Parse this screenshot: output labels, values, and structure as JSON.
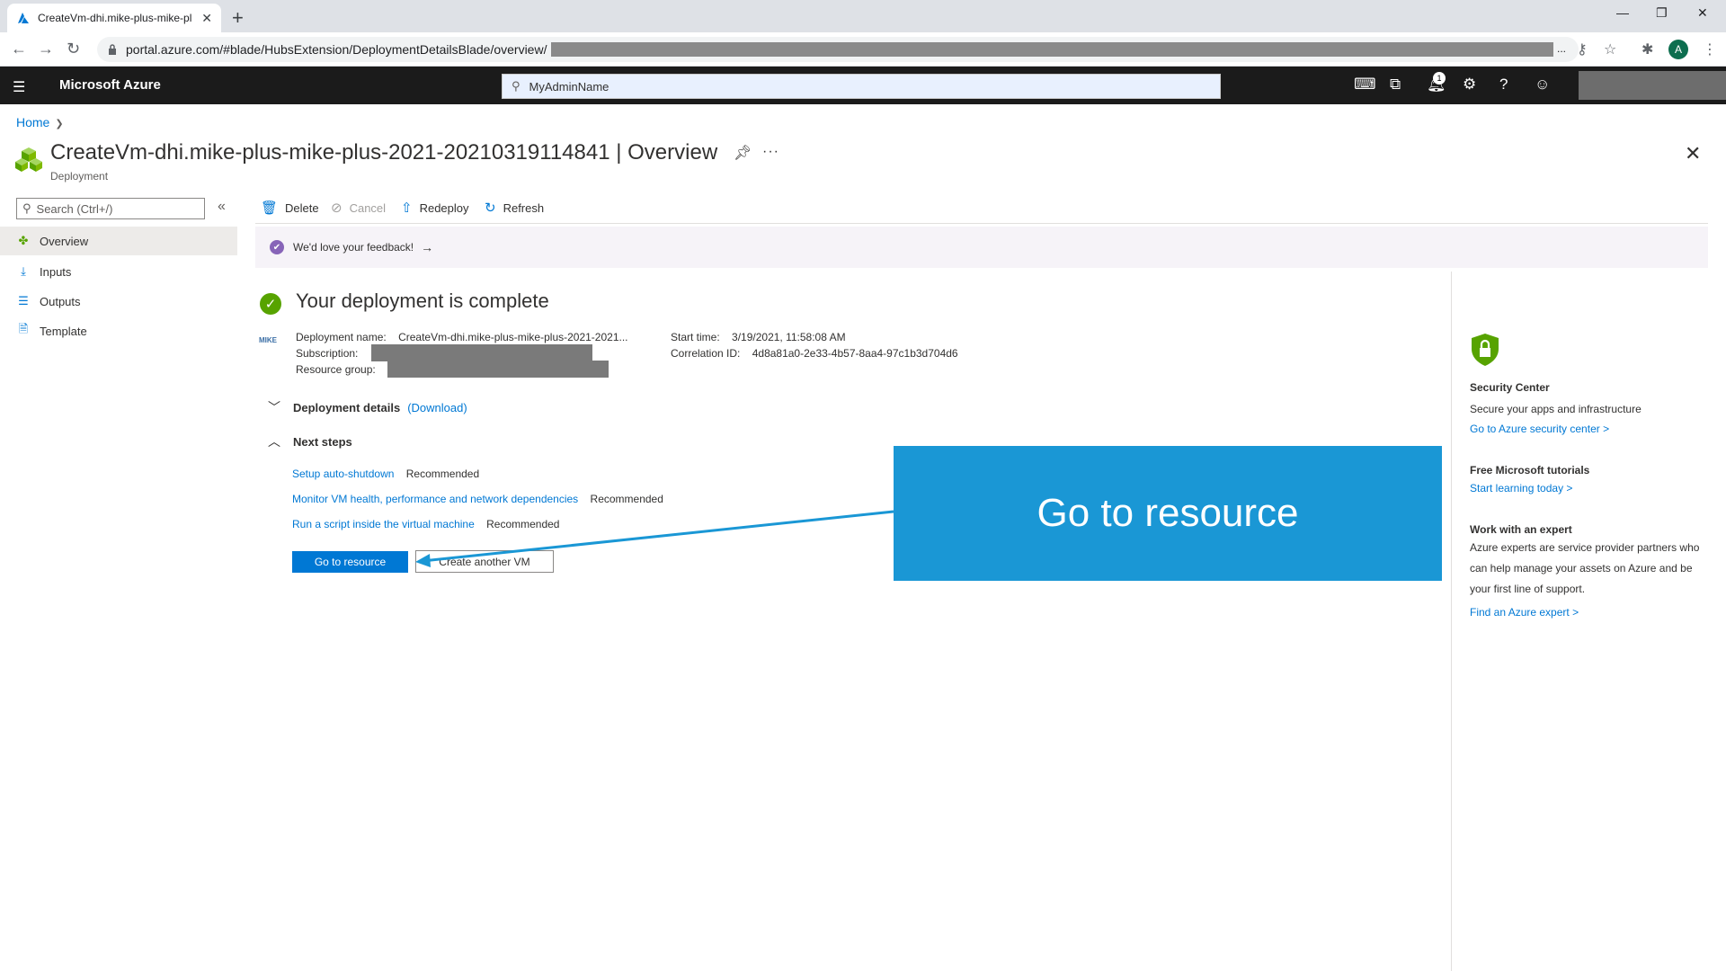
{
  "browser": {
    "tab_title": "CreateVm-dhi.mike-plus-mike-pl",
    "url": "portal.azure.com/#blade/HubsExtension/DeploymentDetailsBlade/overview/",
    "url_ellipsis": "...",
    "avatar_letter": "A"
  },
  "azure": {
    "brand": "Microsoft Azure",
    "search_value": "MyAdminName",
    "notification_count": "1"
  },
  "breadcrumb": {
    "home": "Home"
  },
  "page": {
    "title": "CreateVm-dhi.mike-plus-mike-plus-2021-20210319114841",
    "title_suffix": "| Overview",
    "subtitle": "Deployment"
  },
  "left_menu": {
    "search_placeholder": "Search (Ctrl+/)",
    "items": [
      {
        "label": "Overview"
      },
      {
        "label": "Inputs"
      },
      {
        "label": "Outputs"
      },
      {
        "label": "Template"
      }
    ]
  },
  "commands": {
    "delete": "Delete",
    "cancel": "Cancel",
    "redeploy": "Redeploy",
    "refresh": "Refresh"
  },
  "feedback": {
    "text": "We'd love your feedback!"
  },
  "status": {
    "title": "Your deployment is complete",
    "logo_text": "MIKE"
  },
  "details": {
    "deployment_name_label": "Deployment name:",
    "deployment_name_value": "CreateVm-dhi.mike-plus-mike-plus-2021-2021...",
    "subscription_label": "Subscription:",
    "resource_group_label": "Resource group:",
    "start_time_label": "Start time:",
    "start_time_value": "3/19/2021, 11:58:08 AM",
    "correlation_label": "Correlation ID:",
    "correlation_value": "4d8a81a0-2e33-4b57-8aa4-97c1b3d704d6"
  },
  "sections": {
    "deployment_details": "Deployment details",
    "download": "(Download)",
    "next_steps": "Next steps"
  },
  "next_steps": [
    {
      "link": "Setup auto-shutdown",
      "tag": "Recommended"
    },
    {
      "link": "Monitor VM health, performance and network dependencies",
      "tag": "Recommended"
    },
    {
      "link": "Run a script inside the virtual machine",
      "tag": "Recommended"
    }
  ],
  "buttons": {
    "go_to_resource": "Go to resource",
    "create_another": "Create another VM"
  },
  "callout": {
    "text": "Go to resource",
    "color": "#1a97d5"
  },
  "right_panel": {
    "security_heading": "Security Center",
    "security_text": "Secure your apps and infrastructure",
    "security_link": "Go to Azure security center >",
    "tutorials_heading": "Free Microsoft tutorials",
    "tutorials_link": "Start learning today >",
    "expert_heading": "Work with an expert",
    "expert_text": "Azure experts are service provider partners who can help manage your assets on Azure and be your first line of support.",
    "expert_link": "Find an Azure expert >"
  },
  "colors": {
    "accent": "#0078d4",
    "success": "#57a300",
    "header_bg": "#1b1b1b"
  }
}
